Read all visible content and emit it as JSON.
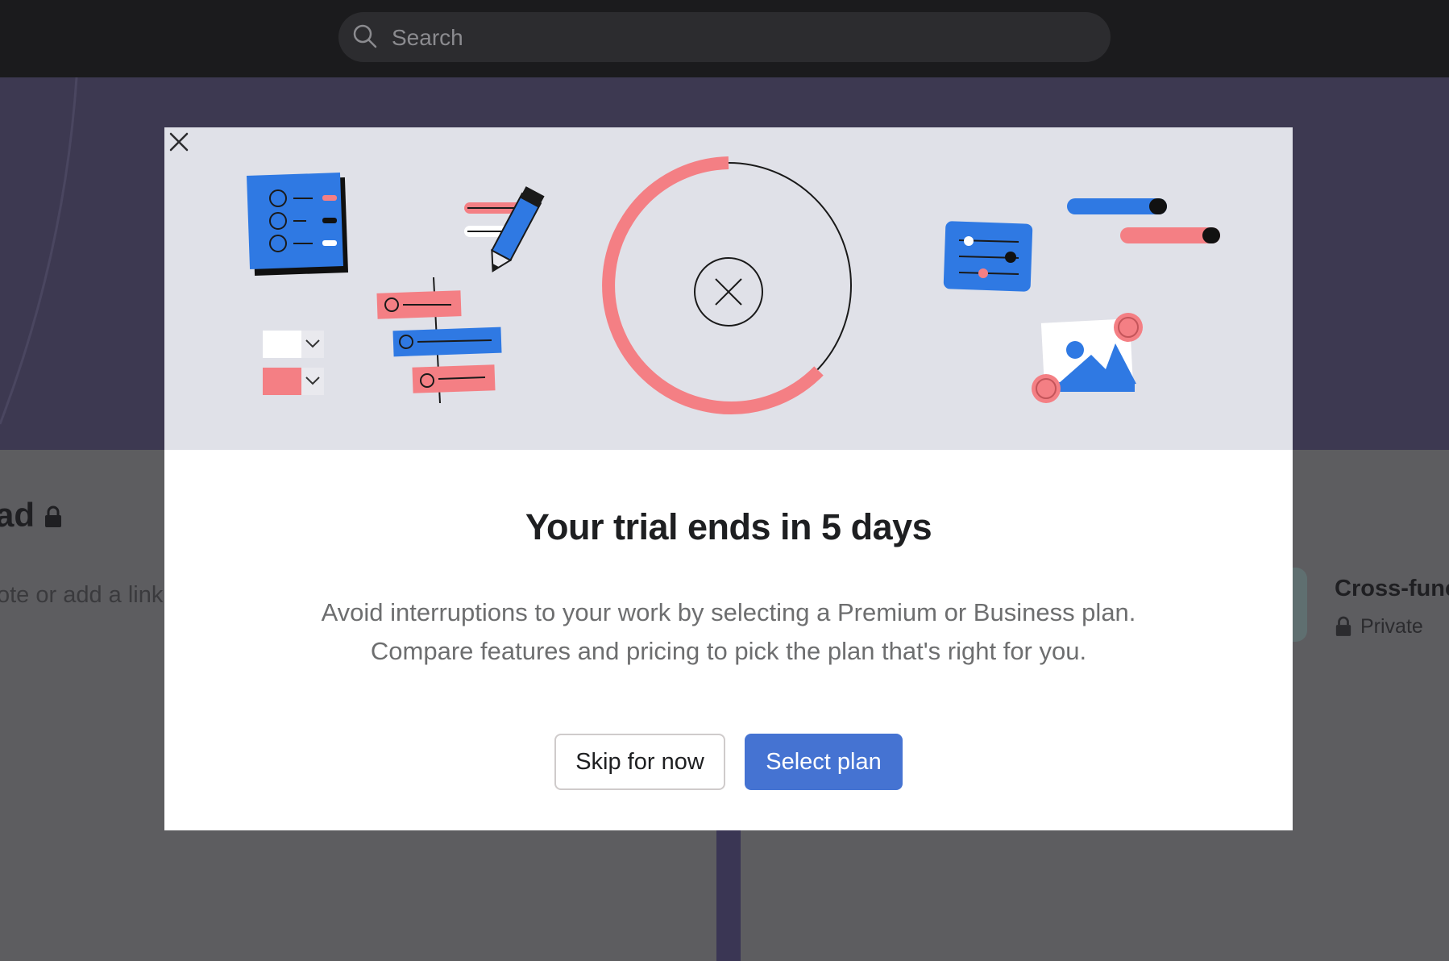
{
  "search": {
    "placeholder": "Search"
  },
  "background": {
    "project_title_fragment": "ad",
    "note_fragment": "ote or add a link",
    "side_project_title": "Cross-func",
    "side_project_privacy": "Private"
  },
  "modal": {
    "title": "Your trial ends in 5 days",
    "body_line1": "Avoid interruptions to your work by selecting a Premium or Business plan.",
    "body_line2": "Compare features and pricing to pick the plan that's right for you.",
    "skip_label": "Skip for now",
    "select_label": "Select plan",
    "close_icon": "close-icon"
  },
  "colors": {
    "primary_button": "#4573d2",
    "accent_coral": "#f47f84",
    "accent_blue": "#2f79e3",
    "illustration_bg": "#e0e1e8"
  }
}
